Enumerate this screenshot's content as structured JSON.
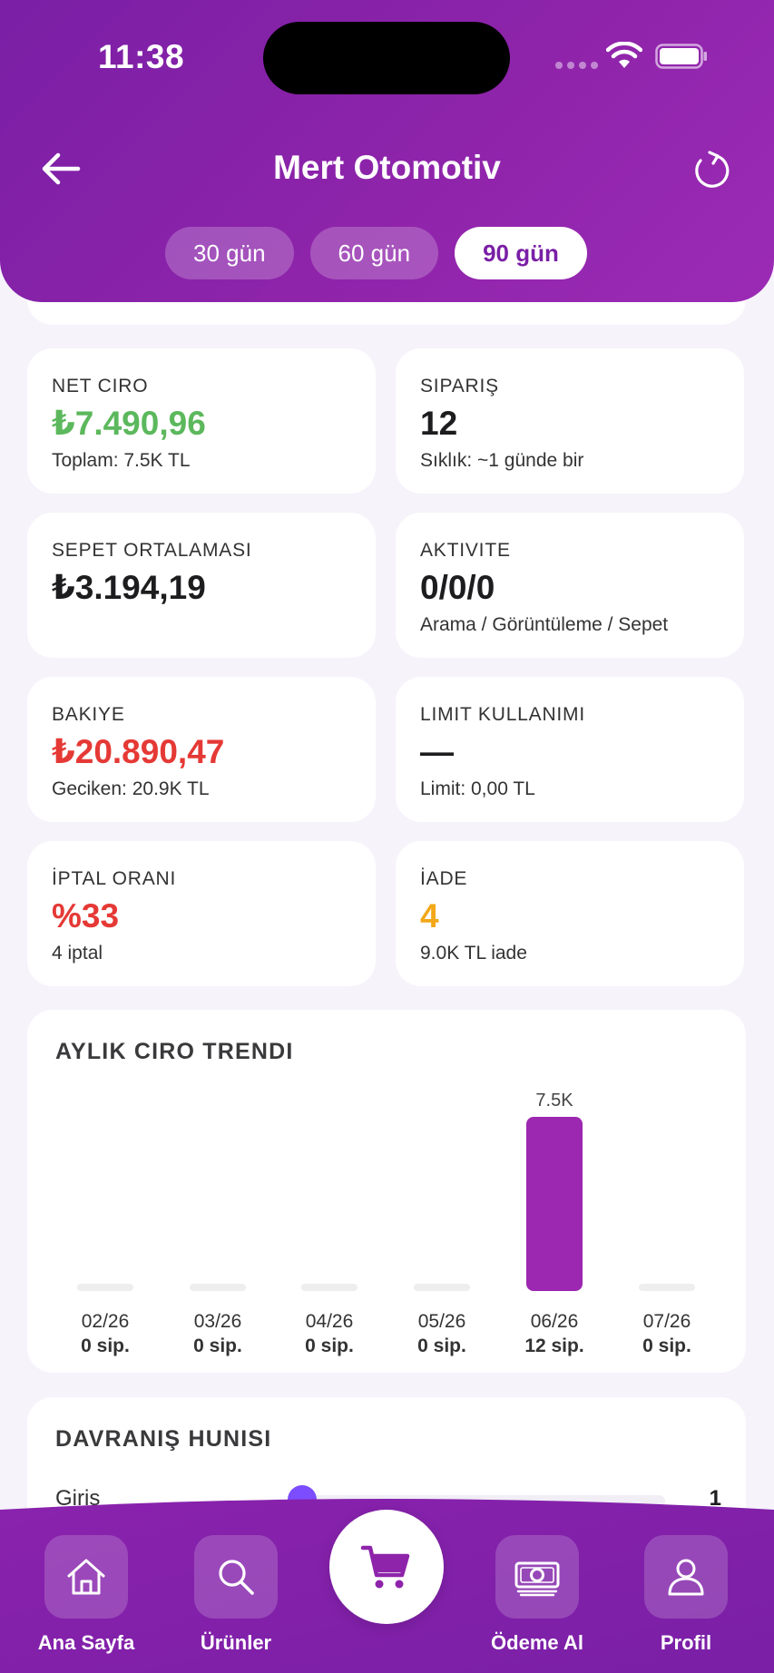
{
  "status_bar": {
    "time": "11:38"
  },
  "header": {
    "title": "Mert Otomotiv",
    "tabs": [
      {
        "label": "30 gün",
        "active": false
      },
      {
        "label": "60 gün",
        "active": false
      },
      {
        "label": "90 gün",
        "active": true
      }
    ]
  },
  "stats": {
    "net_ciro": {
      "label": "NET CIRO",
      "value": "₺7.490,96",
      "sub": "Toplam: 7.5K TL",
      "color": "#5cb85c"
    },
    "siparis": {
      "label": "SIPARIŞ",
      "value": "12",
      "sub": "Sıklık: ~1 günde bir"
    },
    "sepet": {
      "label": "SEPET ORTALAMASI",
      "value": "₺3.194,19",
      "sub": ""
    },
    "aktivite": {
      "label": "AKTIVITE",
      "value": "0/0/0",
      "sub": "Arama / Görüntüleme / Sepet"
    },
    "bakiye": {
      "label": "BAKIYE",
      "value": "₺20.890,47",
      "sub": "Geciken: 20.9K TL",
      "color": "#e53935"
    },
    "limit": {
      "label": "LIMIT KULLANIMI",
      "value": "—",
      "sub": "Limit: 0,00 TL"
    },
    "iptal": {
      "label": "İPTAL ORANI",
      "value": "%33",
      "sub": "4 iptal",
      "color": "#e53935"
    },
    "iade": {
      "label": "İADE",
      "value": "4",
      "sub": "9.0K TL iade",
      "color": "#f2a818"
    }
  },
  "chart_card": {
    "heading": "AYLIK CIRO TRENDI"
  },
  "chart_data": {
    "type": "bar",
    "title": "AYLIK CIRO TRENDI",
    "categories": [
      "02/26",
      "03/26",
      "04/26",
      "05/26",
      "06/26",
      "07/26"
    ],
    "values": [
      0,
      0,
      0,
      0,
      7500,
      0
    ],
    "value_labels": [
      "",
      "",
      "",
      "",
      "7.5K",
      ""
    ],
    "order_labels": [
      "0 sip.",
      "0 sip.",
      "0 sip.",
      "0 sip.",
      "12 sip.",
      "0 sip."
    ],
    "ylim": [
      0,
      7500
    ],
    "bar_color": "#9c27b0",
    "empty_color": "#eeeeee",
    "grid": false,
    "legend": "none"
  },
  "funnel": {
    "heading": "DAVRANIŞ HUNISI",
    "rows": [
      {
        "label": "Giriş",
        "count": "1"
      }
    ]
  },
  "nav": {
    "home": "Ana Sayfa",
    "products": "Ürünler",
    "payment": "Ödeme Al",
    "profile": "Profil"
  },
  "colors": {
    "brand": "#8e24aa",
    "accent": "#7b4dff"
  }
}
